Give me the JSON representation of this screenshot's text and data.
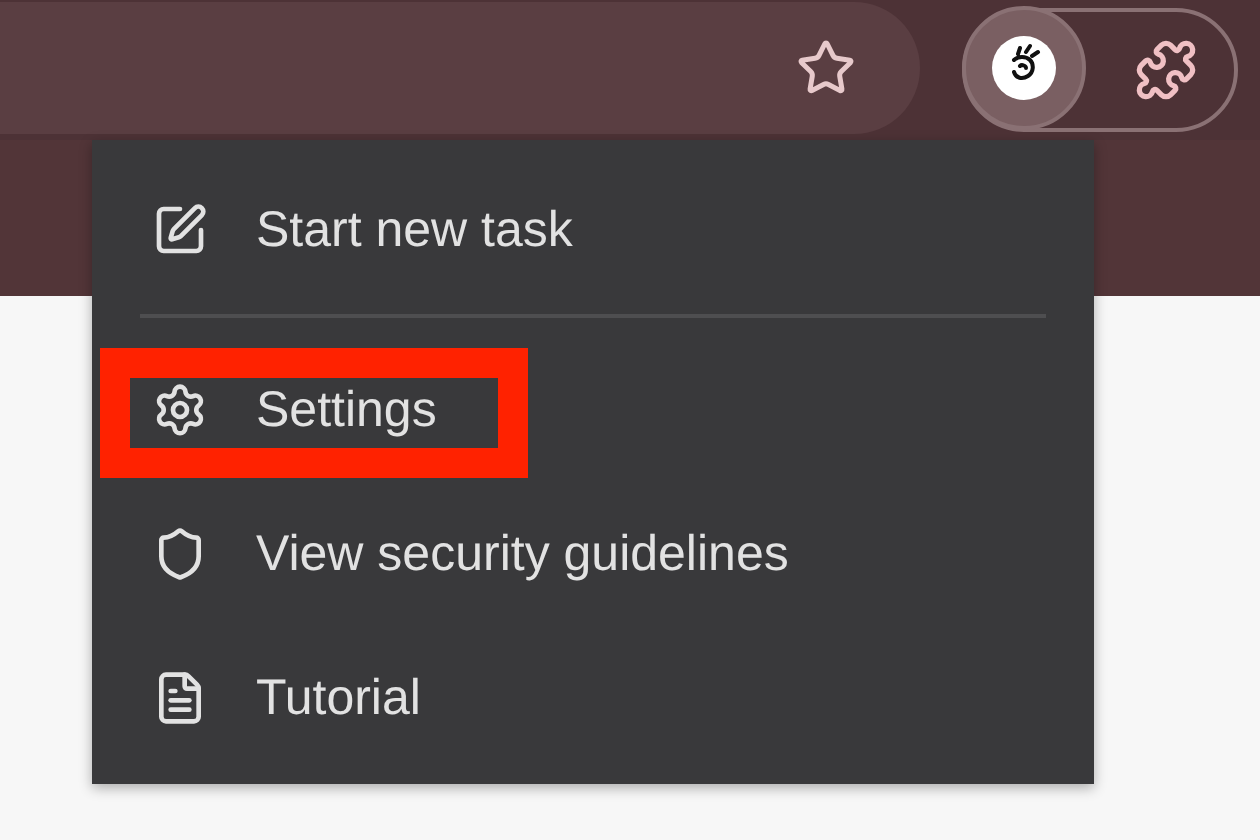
{
  "menu": {
    "items": [
      {
        "kind": "new-task",
        "label": "Start new task",
        "highlighted": false
      },
      {
        "kind": "settings",
        "label": "Settings",
        "highlighted": true
      },
      {
        "kind": "security",
        "label": "View security guidelines",
        "highlighted": false
      },
      {
        "kind": "tutorial",
        "label": "Tutorial",
        "highlighted": false
      }
    ]
  }
}
